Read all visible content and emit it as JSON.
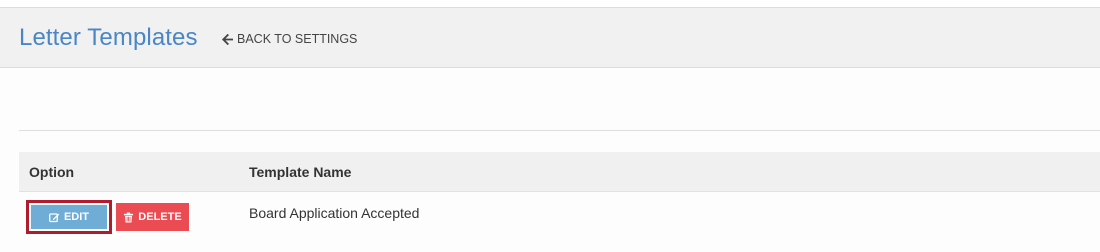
{
  "header": {
    "title": "Letter Templates",
    "back_label": "BACK TO SETTINGS"
  },
  "table": {
    "columns": [
      "Option",
      "Template Name"
    ],
    "rows": [
      {
        "edit_label": "EDIT",
        "delete_label": "DELETE",
        "template_name": "Board Application Accepted"
      }
    ]
  },
  "icons": {
    "back": "arrow-left-icon",
    "edit": "edit-icon",
    "delete": "trash-icon"
  },
  "colors": {
    "title": "#4a86c5",
    "edit_button": "#6fadd7",
    "delete_button": "#eb4b52",
    "focus_outline": "#b01b2e"
  }
}
